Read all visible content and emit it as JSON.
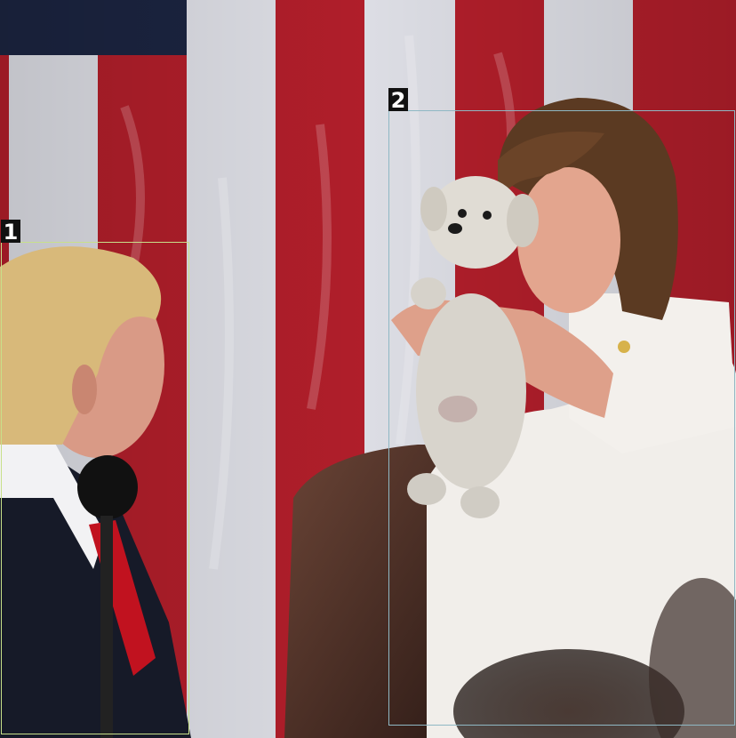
{
  "image": {
    "description_colors": {
      "flag_red": "#b01e2a",
      "flag_white": "#dcdde4",
      "flag_blue": "#1b2440"
    }
  },
  "annotations": [
    {
      "label": "1",
      "color": "#c8e08a"
    },
    {
      "label": "2",
      "color": "#8fb8c4"
    }
  ]
}
